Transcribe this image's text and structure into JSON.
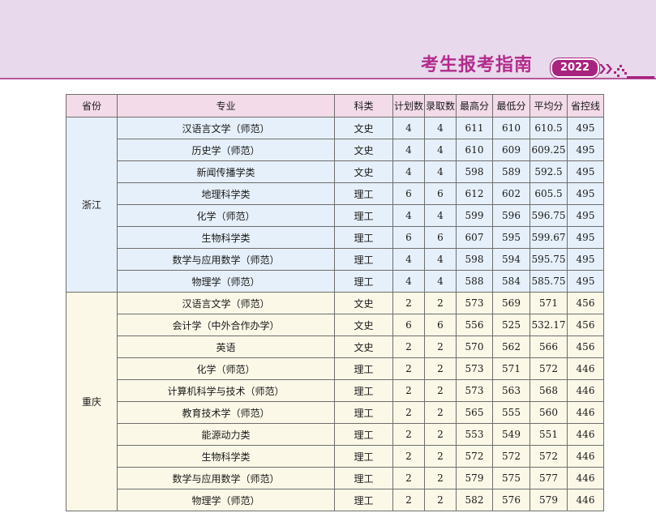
{
  "header": {
    "title": "考生报考指南",
    "year": "2022"
  },
  "table": {
    "columns": [
      "省份",
      "专业",
      "科类",
      "计划数",
      "录取数",
      "最高分",
      "最低分",
      "平均分",
      "省控线"
    ],
    "groups": [
      {
        "province": "浙江",
        "rows": [
          [
            "汉语言文学（师范）",
            "文史",
            "4",
            "4",
            "611",
            "610",
            "610.5",
            "495"
          ],
          [
            "历史学（师范）",
            "文史",
            "4",
            "4",
            "610",
            "609",
            "609.25",
            "495"
          ],
          [
            "新闻传播学类",
            "文史",
            "4",
            "4",
            "598",
            "589",
            "592.5",
            "495"
          ],
          [
            "地理科学类",
            "理工",
            "6",
            "6",
            "612",
            "602",
            "605.5",
            "495"
          ],
          [
            "化学（师范）",
            "理工",
            "4",
            "4",
            "599",
            "596",
            "596.75",
            "495"
          ],
          [
            "生物科学类",
            "理工",
            "6",
            "6",
            "607",
            "595",
            "599.67",
            "495"
          ],
          [
            "数学与应用数学（师范）",
            "理工",
            "4",
            "4",
            "598",
            "594",
            "595.75",
            "495"
          ],
          [
            "物理学（师范）",
            "理工",
            "4",
            "4",
            "588",
            "584",
            "585.75",
            "495"
          ]
        ]
      },
      {
        "province": "重庆",
        "rows": [
          [
            "汉语言文学（师范）",
            "文史",
            "2",
            "2",
            "573",
            "569",
            "571",
            "456"
          ],
          [
            "会计学（中外合作办学）",
            "文史",
            "6",
            "6",
            "556",
            "525",
            "532.17",
            "456"
          ],
          [
            "英语",
            "文史",
            "2",
            "2",
            "570",
            "562",
            "566",
            "456"
          ],
          [
            "化学（师范）",
            "理工",
            "2",
            "2",
            "573",
            "571",
            "572",
            "446"
          ],
          [
            "计算机科学与技术（师范）",
            "理工",
            "2",
            "2",
            "573",
            "563",
            "568",
            "446"
          ],
          [
            "教育技术学（师范）",
            "理工",
            "2",
            "2",
            "565",
            "555",
            "560",
            "446"
          ],
          [
            "能源动力类",
            "理工",
            "2",
            "2",
            "553",
            "549",
            "551",
            "446"
          ],
          [
            "生物科学类",
            "理工",
            "2",
            "2",
            "572",
            "572",
            "572",
            "446"
          ],
          [
            "数学与应用数学（师范）",
            "理工",
            "2",
            "2",
            "579",
            "575",
            "577",
            "446"
          ],
          [
            "物理学（师范）",
            "理工",
            "2",
            "2",
            "582",
            "576",
            "579",
            "446"
          ]
        ]
      }
    ]
  },
  "colors": {
    "band": "#e9d9ec",
    "accent": "#b22c8c",
    "header_fill": "#f3dbe9",
    "group1_fill": "#e6f0fa",
    "group2_fill": "#fbf8e7"
  }
}
